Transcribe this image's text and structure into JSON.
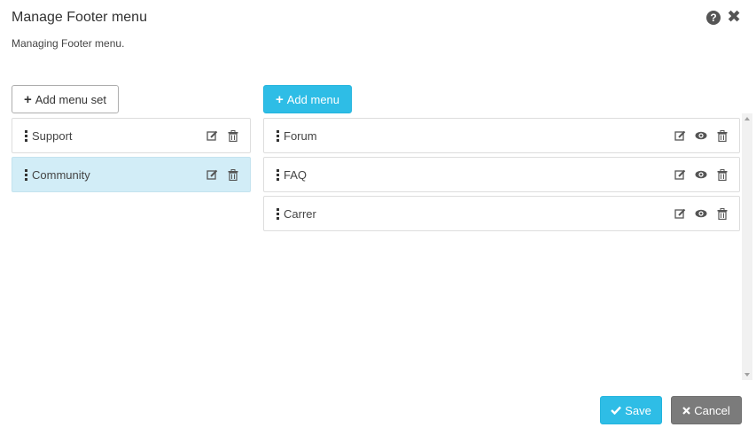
{
  "dialog": {
    "title": "Manage Footer menu",
    "subtitle": "Managing Footer menu."
  },
  "header_icons": [
    "help-icon",
    "close-icon"
  ],
  "menu_sets": {
    "add_button": "Add menu set",
    "items": [
      {
        "label": "Support",
        "active": false
      },
      {
        "label": "Community",
        "active": true
      }
    ]
  },
  "menus": {
    "add_button": "Add menu",
    "items": [
      {
        "label": "Forum"
      },
      {
        "label": "FAQ"
      },
      {
        "label": "Carrer"
      }
    ]
  },
  "footer": {
    "save_label": "Save",
    "cancel_label": "Cancel"
  },
  "colors": {
    "primary": "#2ebde6",
    "active_row": "#d2edf7",
    "cancel": "#7b7b7b"
  }
}
